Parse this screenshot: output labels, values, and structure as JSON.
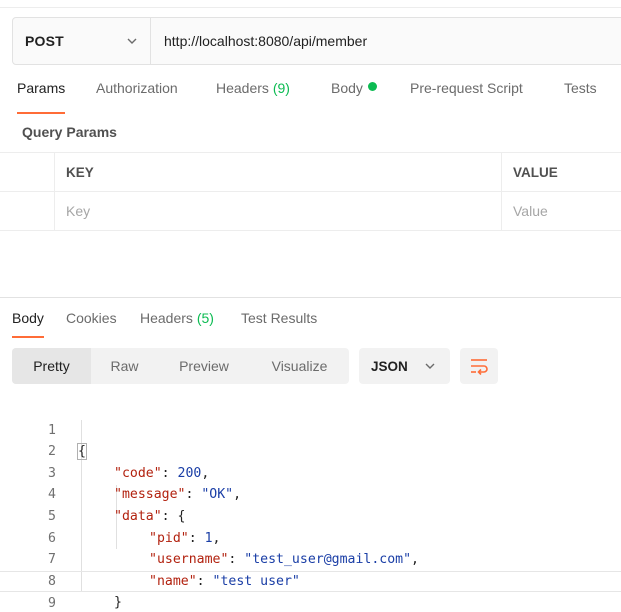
{
  "request": {
    "method": "POST",
    "url": "http://localhost:8080/api/member"
  },
  "request_tabs": [
    {
      "label": "Params",
      "active": true
    },
    {
      "label": "Authorization"
    },
    {
      "label": "Headers",
      "count": "(9)"
    },
    {
      "label": "Body",
      "indicator": "green-dot"
    },
    {
      "label": "Pre-request Script"
    },
    {
      "label": "Tests"
    }
  ],
  "query_params": {
    "title": "Query Params",
    "columns": [
      "KEY",
      "VALUE"
    ],
    "placeholders": {
      "key": "Key",
      "value": "Value"
    }
  },
  "response_tabs": [
    {
      "label": "Body",
      "active": true
    },
    {
      "label": "Cookies"
    },
    {
      "label": "Headers",
      "count": "(5)"
    },
    {
      "label": "Test Results"
    }
  ],
  "view_modes": [
    "Pretty",
    "Raw",
    "Preview",
    "Visualize"
  ],
  "active_view": "Pretty",
  "format": "JSON",
  "icons": {
    "method_dropdown": "chevron-down-icon",
    "format_dropdown": "chevron-down-icon",
    "wrap": "wrap-lines-icon"
  },
  "colors": {
    "accent": "#ff6c37",
    "success": "#0cbb52",
    "json_key": "#b2220f",
    "json_value": "#1a3ea6"
  },
  "response_body": {
    "line_numbers": [
      "1",
      "2",
      "3",
      "4",
      "5",
      "6",
      "7",
      "8",
      "9"
    ],
    "open_brace": "{",
    "code_key": "\"code\"",
    "code_value": "200",
    "message_key": "\"message\"",
    "message_value": "\"OK\"",
    "data_key": "\"data\"",
    "data_open": "{",
    "pid_key": "\"pid\"",
    "pid_value": "1",
    "username_key": "\"username\"",
    "username_value": "\"test_user@gmail.com\"",
    "name_key": "\"name\"",
    "name_value": "\"test user\"",
    "data_close": "}",
    "close_brace": "}"
  }
}
